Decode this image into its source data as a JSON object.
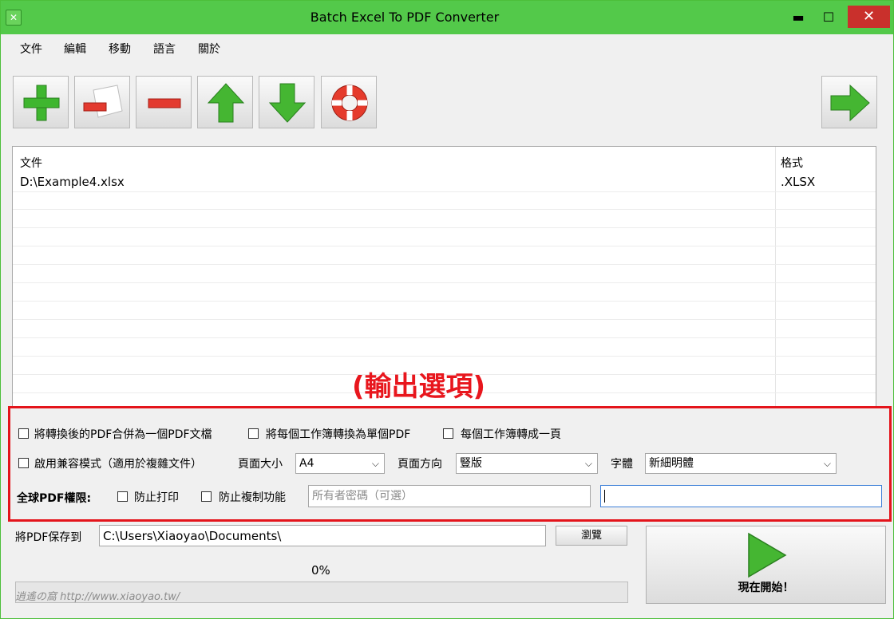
{
  "window": {
    "title": "Batch Excel To PDF Converter",
    "min_glyph": "▬",
    "max_glyph": "☐",
    "close_glyph": "✕"
  },
  "menu": [
    "文件",
    "編輯",
    "移動",
    "語言",
    "關於"
  ],
  "toolbar": {
    "icons": [
      "add-icon",
      "remove-file-icon",
      "remove-icon",
      "move-up-icon",
      "move-down-icon",
      "help-lifebuoy-icon",
      "next-arrow-icon"
    ]
  },
  "file_list": {
    "columns": [
      "文件",
      "格式"
    ],
    "rows": [
      {
        "file": "D:\\Example4.xlsx",
        "format": ".XLSX"
      }
    ]
  },
  "annotation": "(輸出選項)",
  "options": {
    "merge_pdf": "將轉換後的PDF合併為一個PDF文檔",
    "each_workbook_pdf": "將每個工作簿轉換為單個PDF",
    "workbook_one_page": "每個工作簿轉成一頁",
    "compat_mode": "啟用兼容模式（適用於複雜文件）",
    "page_size_label": "頁面大小",
    "page_size_value": "A4",
    "orientation_label": "頁面方向",
    "orientation_value": "豎版",
    "font_label": "字體",
    "font_value": "新細明體",
    "global_perm_label": "全球PDF權限:",
    "no_print": "防止打印",
    "no_copy": "防止複制功能",
    "owner_password_placeholder": "所有者密碼（可選）",
    "user_password_value": ""
  },
  "output": {
    "save_label": "將PDF保存到",
    "save_path": "C:\\Users\\Xiaoyao\\Documents\\",
    "browse_label": "瀏覽"
  },
  "progress": {
    "text": "0%",
    "value": 0
  },
  "start_button": {
    "label": "現在開始！"
  },
  "colors": {
    "titlebar": "#53c94a",
    "close": "#c9302c",
    "highlight": "#e4141b"
  }
}
